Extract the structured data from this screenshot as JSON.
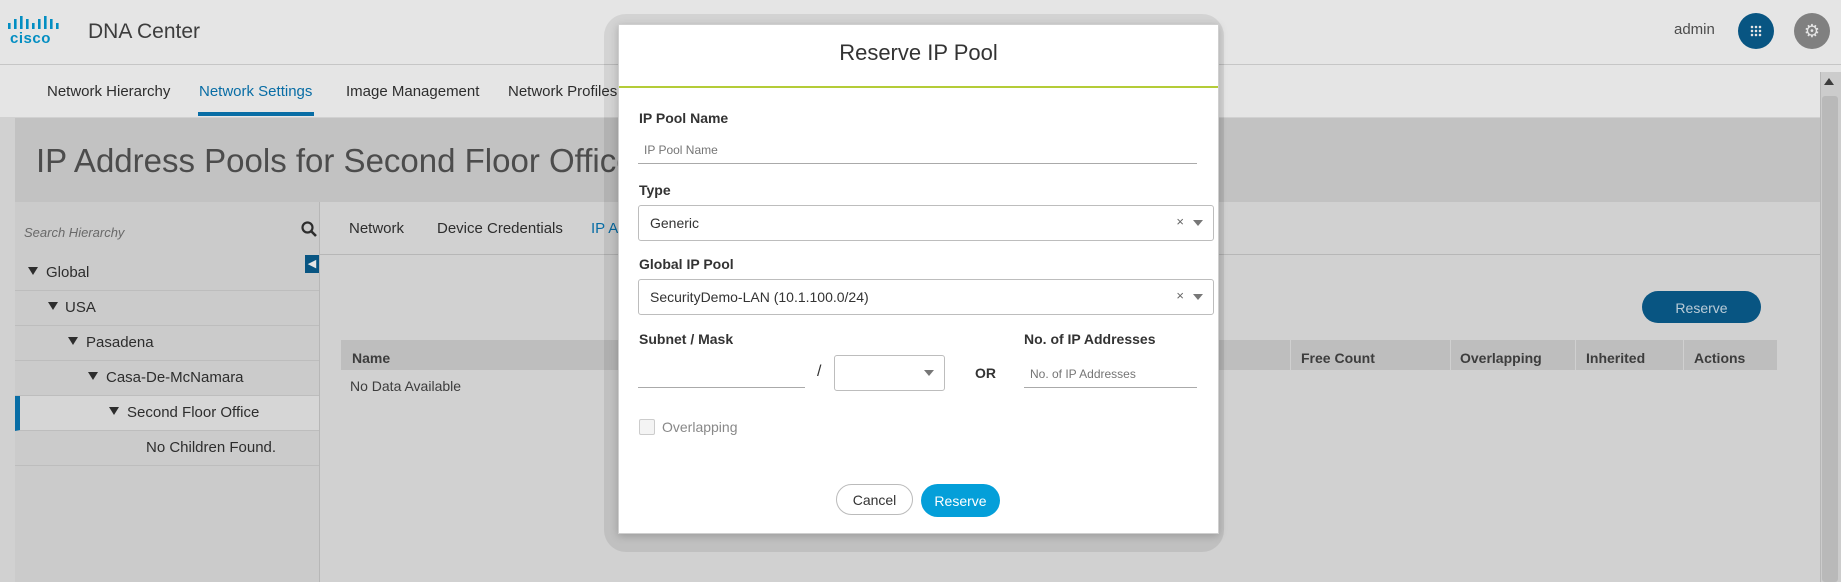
{
  "header": {
    "logo_text": "cisco",
    "app_title": "DNA Center",
    "user": "admin"
  },
  "nav": {
    "items": [
      "Network Hierarchy",
      "Network Settings",
      "Image Management",
      "Network Profiles"
    ],
    "active": "Network Settings"
  },
  "page": {
    "title": "IP Address Pools for Second Floor Office"
  },
  "sidebar": {
    "search_placeholder": "Search Hierarchy",
    "tree": [
      "Global",
      "USA",
      "Pasadena",
      "Casa-De-McNamara",
      "Second Floor Office",
      "No Children Found."
    ],
    "selected": "Second Floor Office"
  },
  "tabs": {
    "items": [
      "Network",
      "Device Credentials",
      "IP A"
    ],
    "active": "IP A"
  },
  "table": {
    "reserve_label": "Reserve",
    "columns": [
      "Name",
      "Free Count",
      "Overlapping",
      "Inherited",
      "Actions"
    ],
    "empty_text": "No Data Available"
  },
  "modal": {
    "title": "Reserve IP Pool",
    "pool_name_label": "IP Pool Name",
    "pool_name_placeholder": "IP Pool Name",
    "type_label": "Type",
    "type_value": "Generic",
    "global_pool_label": "Global IP Pool",
    "global_pool_value": "SecurityDemo-LAN (10.1.100.0/24)",
    "subnet_label": "Subnet / Mask",
    "slash": "/",
    "or_label": "OR",
    "num_addresses_label": "No. of IP Addresses",
    "num_addresses_placeholder": "No. of IP Addresses",
    "overlapping_label": "Overlapping",
    "clear_glyph": "×",
    "cancel_label": "Cancel",
    "reserve_label": "Reserve"
  },
  "colors": {
    "accent": "#049fd9",
    "nav_active": "#0a7ab8",
    "modal_title_line": "#b4cc38"
  }
}
